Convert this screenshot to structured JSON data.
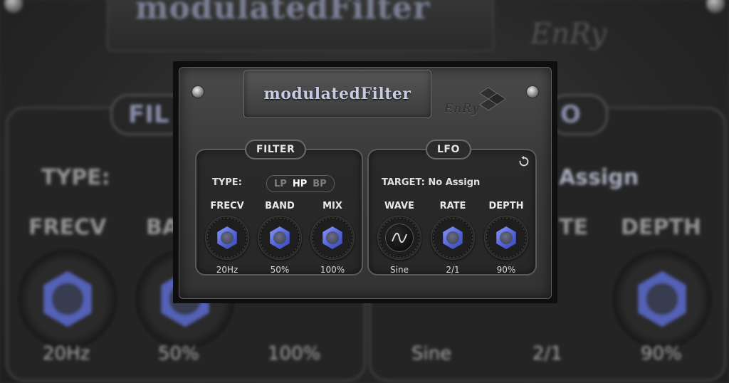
{
  "app": {
    "title": "modulatedFilter",
    "logo_text": "EnRy"
  },
  "filter": {
    "section_label": "FILTER",
    "type_label": "TYPE:",
    "type_options": [
      "LP",
      "HP",
      "BP"
    ],
    "type_selected": "HP",
    "knobs": [
      {
        "label": "FRECV",
        "value": "20Hz"
      },
      {
        "label": "BAND",
        "value": "50%"
      },
      {
        "label": "MIX",
        "value": "100%"
      }
    ]
  },
  "lfo": {
    "section_label": "LFO",
    "target_label": "TARGET:",
    "target_value": "No Assign",
    "knobs": [
      {
        "label": "WAVE",
        "value": "Sine"
      },
      {
        "label": "RATE",
        "value": "2/1"
      },
      {
        "label": "DEPTH",
        "value": "90%"
      }
    ]
  },
  "background": {
    "title": "modulatedFilter",
    "filter_pill": "FIL",
    "lfo_pill": "O",
    "type_label": "TYPE:",
    "assign_text": "Assign",
    "labels": [
      "FRECV",
      "BA",
      "TE",
      "DEPTH"
    ],
    "values": [
      "20Hz",
      "50%",
      "100%",
      "Sine",
      "2/1",
      "90%"
    ]
  },
  "colors": {
    "accent": "#5b6bd0",
    "panel": "#3a3a3a",
    "text": "#e0e0e0"
  }
}
